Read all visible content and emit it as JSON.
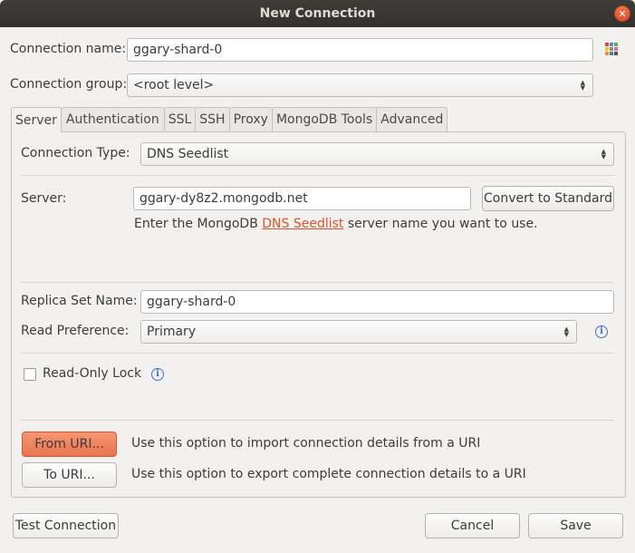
{
  "window": {
    "title": "New Connection",
    "close_glyph": "✕"
  },
  "connection": {
    "name_label": "Connection name:",
    "name_value": "ggary-shard-0",
    "group_label": "Connection group:",
    "group_value": "<root level>"
  },
  "tabs": [
    {
      "label": "Server",
      "active": true
    },
    {
      "label": "Authentication"
    },
    {
      "label": "SSL"
    },
    {
      "label": "SSH"
    },
    {
      "label": "Proxy"
    },
    {
      "label": "MongoDB Tools"
    },
    {
      "label": "Advanced"
    }
  ],
  "server_tab": {
    "type_label": "Connection Type:",
    "type_value": "DNS Seedlist",
    "server_label": "Server:",
    "server_value": "ggary-dy8z2.mongodb.net",
    "convert_button": "Convert to Standard",
    "hint_prefix": "Enter the MongoDB ",
    "hint_link": "DNS Seedlist",
    "hint_suffix": " server name you want to use.",
    "replica_label": "Replica Set Name:",
    "replica_value": "ggary-shard-0",
    "read_pref_label": "Read Preference:",
    "read_pref_value": "Primary",
    "readonly_label": "Read-Only Lock",
    "readonly_checked": false,
    "from_uri_button": "From URI...",
    "from_uri_desc": "Use this option to import connection details from a URI",
    "to_uri_button": "To URI...",
    "to_uri_desc": "Use this option to export complete connection details to a URI"
  },
  "footer": {
    "test_button": "Test Connection",
    "cancel_button": "Cancel",
    "save_button": "Save"
  },
  "icons": {
    "info": "i",
    "combo_arrows": "▲▼",
    "color_picker": "color-picker-icon"
  },
  "colors": {
    "accent_orange": "#e9744f",
    "link": "#d9532b",
    "info_blue": "#3f6fd1",
    "titlebar": "#3a3935"
  }
}
